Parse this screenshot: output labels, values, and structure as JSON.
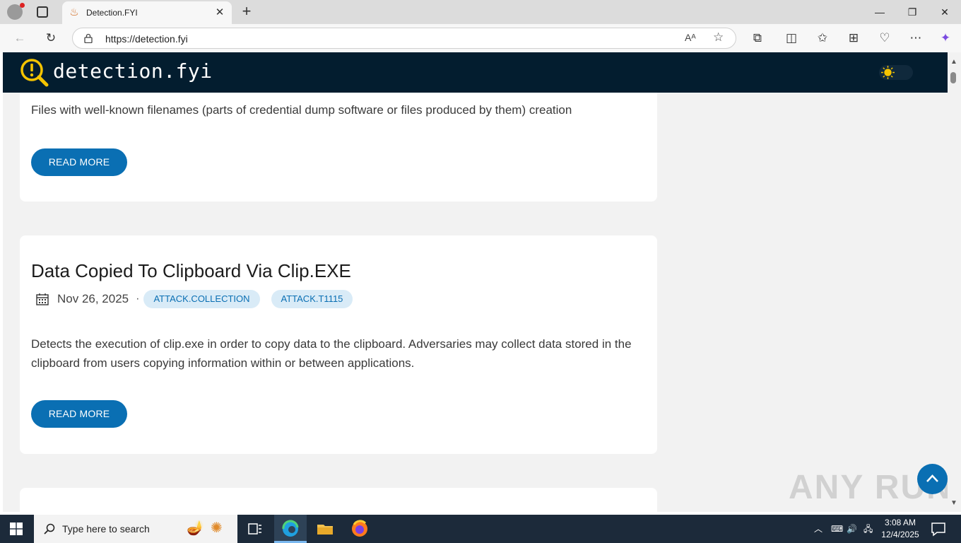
{
  "browser": {
    "tab_title": "Detection.FYI",
    "tab_close_glyph": "✕",
    "new_tab_glyph": "+",
    "url": "https://detection.fyi",
    "window_controls": {
      "minimize": "—",
      "restore": "❐",
      "close": "✕"
    }
  },
  "site": {
    "logo_text": "detection.fyi"
  },
  "cards": [
    {
      "description": "Files with well-known filenames (parts of credential dump software or files produced by them) creation",
      "read_more": "READ MORE"
    },
    {
      "title": "Data Copied To Clipboard Via Clip.EXE",
      "date": "Nov 26, 2025",
      "separator": "·",
      "tags": [
        "ATTACK.COLLECTION",
        "ATTACK.T1115"
      ],
      "description": "Detects the execution of clip.exe in order to copy data to the clipboard. Adversaries may collect data stored in the clipboard from users copying information within or between applications.",
      "read_more": "READ MORE"
    }
  ],
  "watermark": "ANY RUN",
  "taskbar": {
    "search_placeholder": "Type here to search",
    "time": "3:08 AM",
    "date": "12/4/2025"
  },
  "colors": {
    "header_bg": "#031d2f",
    "accent": "#0a6fb3",
    "tag_bg": "#d9ebf7",
    "logo_yellow": "#f5c400"
  }
}
